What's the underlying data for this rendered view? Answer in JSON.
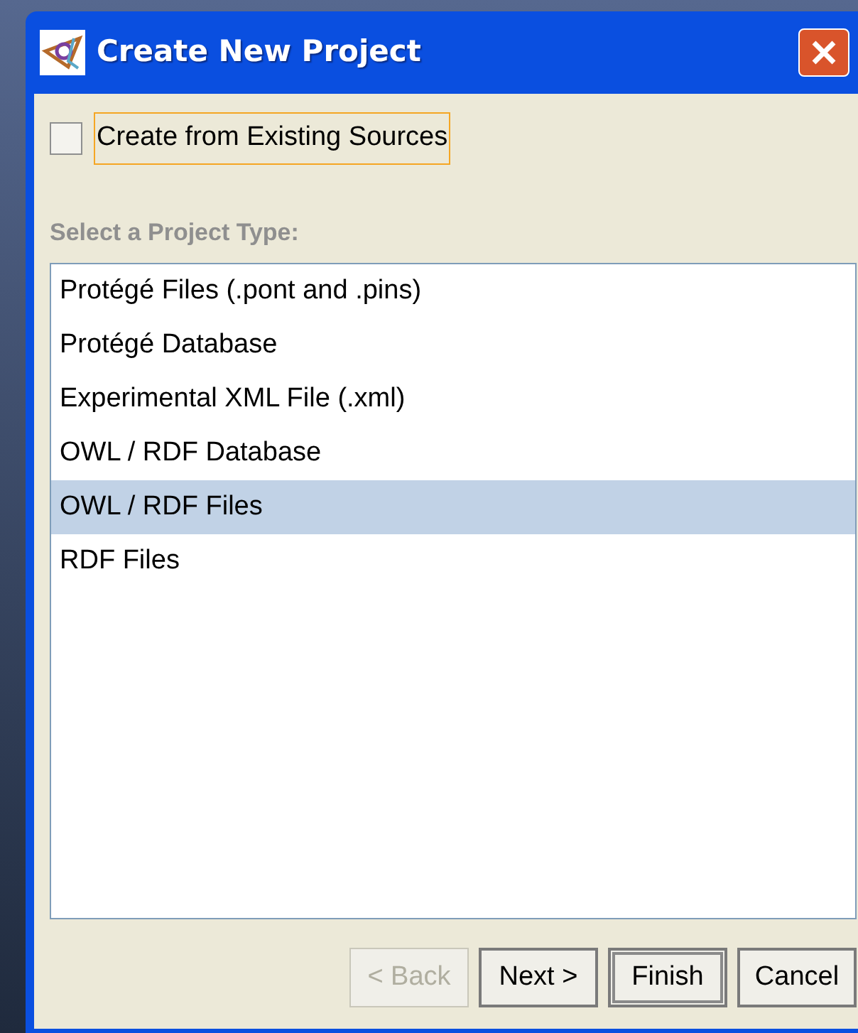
{
  "window": {
    "title": "Create New Project"
  },
  "option": {
    "label": "Create from Existing Sources",
    "checked": false,
    "focused": true
  },
  "section_label": "Select a Project Type:",
  "project_types": [
    {
      "label": "Protégé Files (.pont and .pins)",
      "selected": false
    },
    {
      "label": "Protégé Database",
      "selected": false
    },
    {
      "label": "Experimental XML File (.xml)",
      "selected": false
    },
    {
      "label": "OWL / RDF Database",
      "selected": false
    },
    {
      "label": "OWL / RDF Files",
      "selected": true
    },
    {
      "label": "RDF Files",
      "selected": false
    }
  ],
  "buttons": [
    {
      "label": "< Back",
      "disabled": true,
      "default": false
    },
    {
      "label": "Next >",
      "disabled": false,
      "default": false
    },
    {
      "label": "Finish",
      "disabled": false,
      "default": true
    },
    {
      "label": "Cancel",
      "disabled": false,
      "default": false
    }
  ]
}
